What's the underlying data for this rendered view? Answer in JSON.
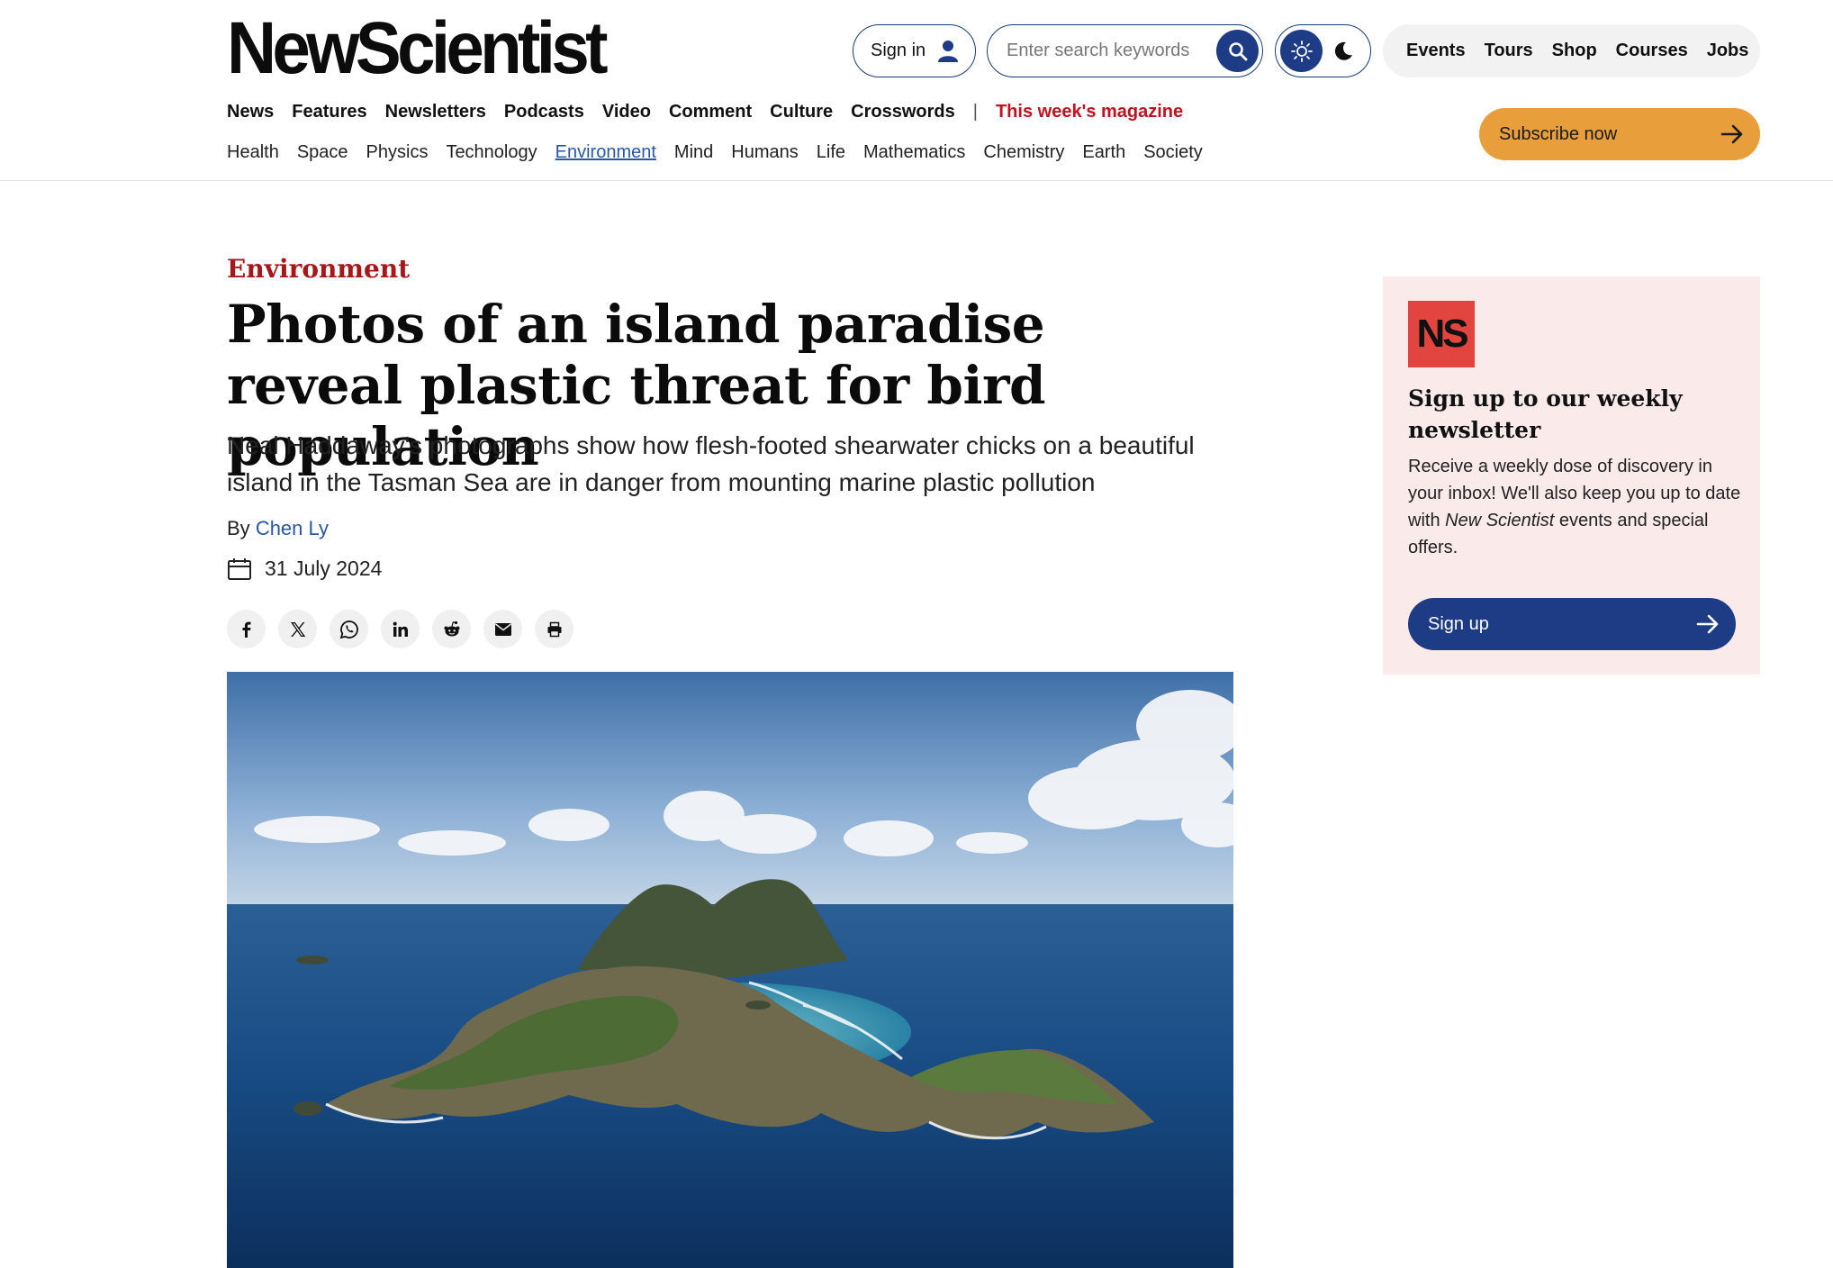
{
  "brand": {
    "logo_text": "NewScientist",
    "accent": "#1e3c85",
    "kicker_color": "#a8161a",
    "subscribe_color": "#e89e3a"
  },
  "header": {
    "signin_label": "Sign in",
    "search_placeholder": "Enter search keywords",
    "util_nav": [
      "Events",
      "Tours",
      "Shop",
      "Courses",
      "Jobs"
    ],
    "main_nav": [
      "News",
      "Features",
      "Newsletters",
      "Podcasts",
      "Video",
      "Comment",
      "Culture",
      "Crosswords"
    ],
    "separator": "|",
    "magazine_link": "This week's magazine",
    "sub_nav": [
      "Health",
      "Space",
      "Physics",
      "Technology",
      "Environment",
      "Mind",
      "Humans",
      "Life",
      "Mathematics",
      "Chemistry",
      "Earth",
      "Society"
    ],
    "active_sub_nav": "Environment",
    "subscribe_label": "Subscribe now"
  },
  "article": {
    "kicker": "Environment",
    "headline": "Photos of an island paradise reveal plastic threat for bird population",
    "standfirst": "Neal Haddaway's photographs show how flesh-footed shearwater chicks on a beautiful island in the Tasman Sea are in danger from mounting marine plastic pollution",
    "byline_prefix": "By",
    "author": "Chen Ly",
    "date": "31 July 2024",
    "share_icons": [
      "facebook-icon",
      "x-icon",
      "whatsapp-icon",
      "linkedin-icon",
      "reddit-icon",
      "email-icon",
      "print-icon"
    ]
  },
  "newsletter": {
    "logo_text": "NS",
    "title": "Sign up to our weekly newsletter",
    "body_before": "Receive a weekly dose of discovery in your inbox! We'll also keep you up to date with ",
    "body_italic": "New Scientist",
    "body_after": " events and special offers.",
    "button_label": "Sign up"
  }
}
